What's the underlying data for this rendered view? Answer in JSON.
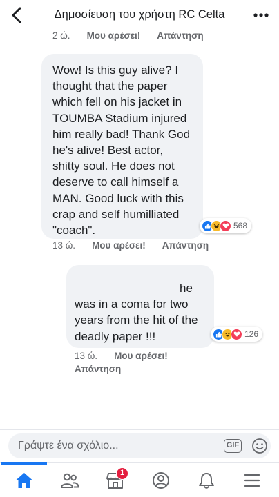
{
  "header": {
    "title": "Δημοσίευση του χρήστη RC Celta"
  },
  "comments": [
    {
      "time": "2 ώ.",
      "like": "Μου αρέσει!",
      "reply": "Απάντηση"
    },
    {
      "lines": [
        "Wow! Is this guy alive? I",
        "thought that the paper",
        "which fell on his jacket in",
        "TOUMBA Stadium injured",
        "him really bad! Thank God",
        "he's alive! Best actor,",
        "shitty soul. He does not",
        "deserve to call himself a",
        "MAN. Good luck with this",
        "crap and self humilliated",
        "\"coach\"."
      ],
      "reactions": [
        "like",
        "haha",
        "love"
      ],
      "reaction_count": "568",
      "time": "13 ώ.",
      "like": "Μου αρέσει!",
      "reply": "Απάντηση"
    },
    {
      "lines": [
        "he",
        "was in a coma for two",
        "years from the hit of the",
        "deadly paper !!!"
      ],
      "reactions": [
        "like",
        "haha",
        "love"
      ],
      "reaction_count": "126",
      "time": "13 ώ.",
      "like": "Μου αρέσει!",
      "reply": "Απάντηση"
    }
  ],
  "composer": {
    "placeholder": "Γράψτε ένα σχόλιο...",
    "gif_label": "GIF"
  },
  "tabs": [
    {
      "icon": "home-icon",
      "active": true
    },
    {
      "icon": "friends-icon"
    },
    {
      "icon": "marketplace-icon",
      "badge": "1"
    },
    {
      "icon": "profile-icon"
    },
    {
      "icon": "notifications-bell-icon"
    },
    {
      "icon": "menu-icon"
    }
  ],
  "colors": {
    "accent": "#1877f2",
    "bubble": "#f0f2f5",
    "secondary_text": "#65676b",
    "like": "#1877f2",
    "haha": "#f7b928",
    "love": "#f33e58",
    "badge": "#e41e3f"
  }
}
